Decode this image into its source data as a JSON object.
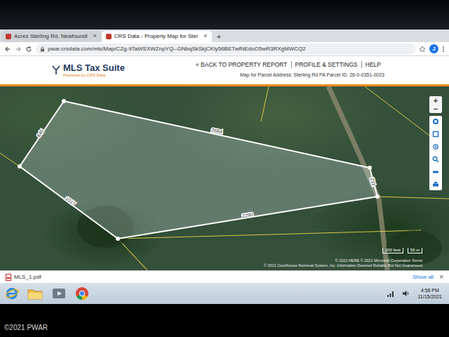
{
  "browser": {
    "tabs": [
      {
        "label": "Acres Sterling Rd, Newfoundl",
        "close": "×",
        "selected": false
      },
      {
        "label": "CRS Data - Property Map for Ster",
        "close": "×",
        "selected": true
      }
    ],
    "new_tab": "+",
    "url": "pwar.crsdata.com/mls/Map/CZg-9TaWSXWZnpYQ--GNbqSkSkjCKly56BETwfNEdoO5wR3RXgMWCQ2",
    "profile": "J"
  },
  "header": {
    "logo": "MLS Tax Suite",
    "powered": "Powered by CRS Data",
    "links": [
      "« BACK TO PROPERTY REPORT",
      "PROFILE & SETTINGS",
      "HELP"
    ],
    "map_for": "Map for Parcel Address: Sterling Rd PA Parcel ID: 26-0-0351-0023"
  },
  "map": {
    "edges": [
      "645",
      "2684",
      "231",
      "2290",
      "1017"
    ],
    "zoom": [
      "+",
      "−"
    ],
    "scale": [
      "200 feet",
      "50 m"
    ],
    "attribution": [
      "© 2021 HERE © 2021 Microsoft Corporation Terms",
      "© 2021 Courthouse Retrieval System, Inc. Information Deemed Reliable But Not Guaranteed"
    ]
  },
  "downloads": {
    "file": "MLS_1.pdf",
    "show_all": "Show all",
    "close": "×"
  },
  "taskbar": {
    "time": "4:58 PM",
    "date": "11/15/2021"
  },
  "watermark": "©2021 PWAR"
}
